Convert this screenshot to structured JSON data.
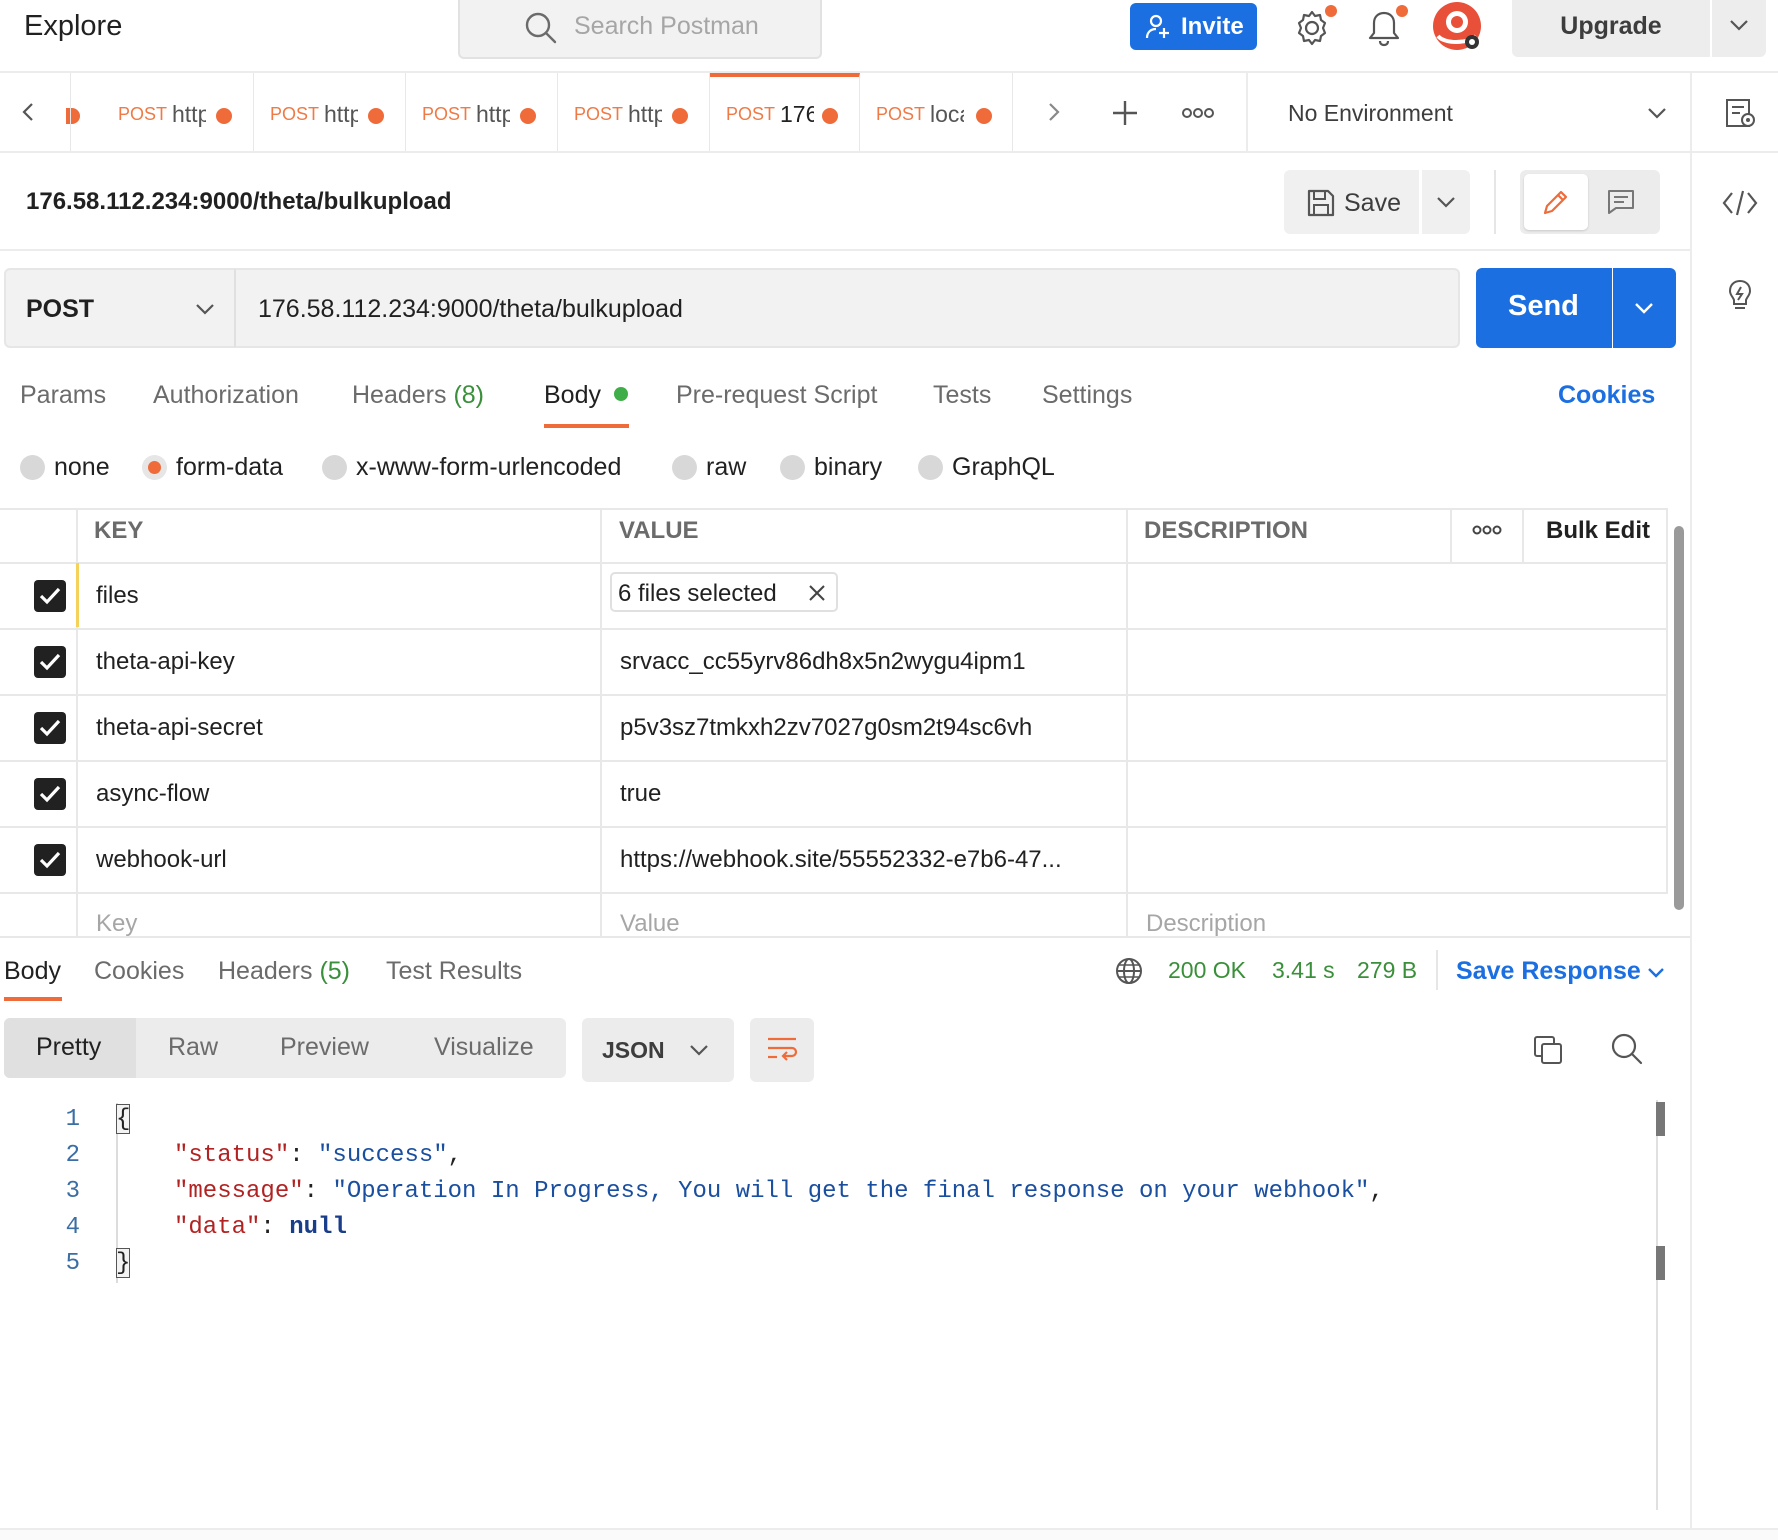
{
  "topbar": {
    "explore": "Explore",
    "search_placeholder": "Search Postman",
    "invite": "Invite",
    "upgrade": "Upgrade"
  },
  "tabs": [
    {
      "method": "POST",
      "url": "http"
    },
    {
      "method": "POST",
      "url": "http"
    },
    {
      "method": "POST",
      "url": "http"
    },
    {
      "method": "POST",
      "url": "http"
    },
    {
      "method": "POST",
      "url": "176",
      "active": true
    },
    {
      "method": "POST",
      "url": "loca"
    }
  ],
  "environment": "No Environment",
  "request": {
    "title": "176.58.112.234:9000/theta/bulkupload",
    "save": "Save",
    "method": "POST",
    "url": "176.58.112.234:9000/theta/bulkupload",
    "send": "Send"
  },
  "request_tabs": {
    "params": "Params",
    "authorization": "Authorization",
    "headers": "Headers",
    "headers_count": "(8)",
    "body": "Body",
    "prerequest": "Pre-request Script",
    "tests": "Tests",
    "settings": "Settings",
    "cookies": "Cookies"
  },
  "body_types": {
    "none": "none",
    "form_data": "form-data",
    "urlencoded": "x-www-form-urlencoded",
    "raw": "raw",
    "binary": "binary",
    "graphql": "GraphQL",
    "selected": "form-data"
  },
  "table": {
    "headers": {
      "key": "KEY",
      "value": "VALUE",
      "description": "DESCRIPTION",
      "bulk_edit": "Bulk Edit"
    },
    "rows": [
      {
        "key": "files",
        "value": "6 files selected",
        "checked": true
      },
      {
        "key": "theta-api-key",
        "value": "srvacc_cc55yrv86dh8x5n2wygu4ipm1",
        "checked": true
      },
      {
        "key": "theta-api-secret",
        "value": "p5v3sz7tmkxh2zv7027g0sm2t94sc6vh",
        "checked": true
      },
      {
        "key": "async-flow",
        "value": "true",
        "checked": true
      },
      {
        "key": "webhook-url",
        "value": "https://webhook.site/55552332-e7b6-47...",
        "checked": true
      }
    ],
    "placeholders": {
      "key": "Key",
      "value": "Value",
      "description": "Description"
    }
  },
  "response": {
    "tabs": {
      "body": "Body",
      "cookies": "Cookies",
      "headers": "Headers",
      "headers_count": "(5)",
      "test_results": "Test Results"
    },
    "status": "200 OK",
    "time": "3.41 s",
    "size": "279 B",
    "save_response": "Save Response",
    "views": {
      "pretty": "Pretty",
      "raw": "Raw",
      "preview": "Preview",
      "visualize": "Visualize"
    },
    "format": "JSON",
    "line_numbers": [
      "1",
      "2",
      "3",
      "4",
      "5"
    ],
    "code": {
      "open": "{",
      "status_key": "\"status\"",
      "status_val": "\"success\"",
      "message_key": "\"message\"",
      "message_val": "\"Operation In Progress, You will get the final response on your webhook\"",
      "data_key": "\"data\"",
      "data_val": "null",
      "close": "}"
    }
  },
  "colors": {
    "accent": "#ef6b3a",
    "primary": "#1c6fe0",
    "success": "#3a8f3a"
  }
}
